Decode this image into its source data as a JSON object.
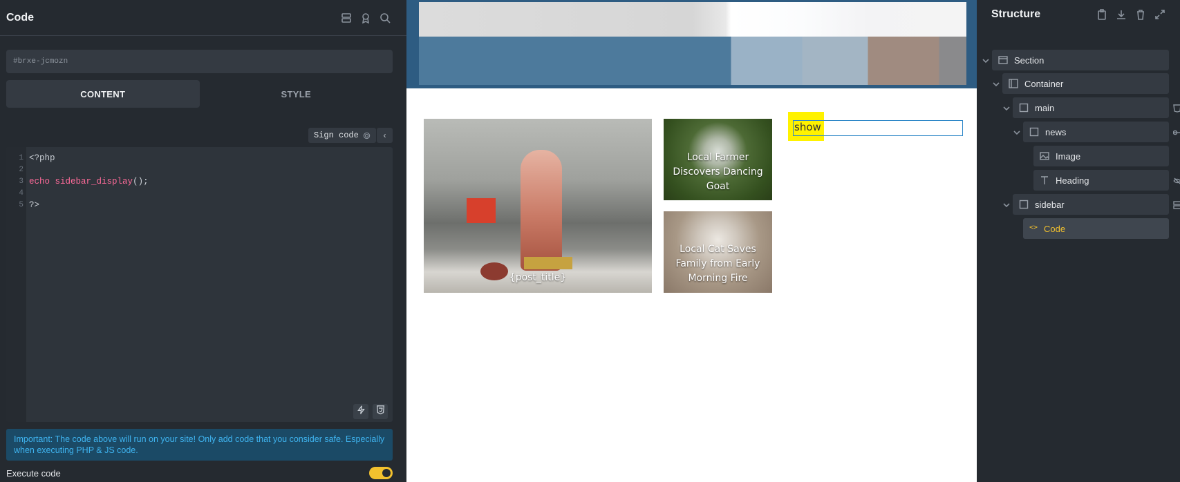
{
  "left_panel": {
    "title": "Code",
    "selector": "#brxe-jcmozn",
    "tabs": [
      "CONTENT",
      "STYLE"
    ],
    "sign_code_label": "Sign code",
    "code_lines": [
      {
        "num": "1",
        "text": "<?php"
      },
      {
        "num": "2",
        "text": ""
      },
      {
        "num": "3",
        "keyword": "echo",
        "func": "sidebar_display",
        "rest": "();"
      },
      {
        "num": "4",
        "text": ""
      },
      {
        "num": "5",
        "text": "?>"
      }
    ],
    "warning": "Important: The code above will run on your site! Only add code that you consider safe. Especially when executing PHP & JS code.",
    "execute_label": "Execute code",
    "execute_enabled": true,
    "accent_color": "#f2c12e"
  },
  "canvas": {
    "news_main_caption": "{post_title}",
    "news_items": [
      "Local Farmer Discovers Dancing Goat",
      "Local Cat Saves Family from Early Morning Fire"
    ],
    "sidebar_output": "show"
  },
  "structure": {
    "title": "Structure",
    "nodes": [
      {
        "label": "Section",
        "icon": "section-icon"
      },
      {
        "label": "Container",
        "icon": "container-icon"
      },
      {
        "label": "main",
        "icon": "block-icon"
      },
      {
        "label": "news",
        "icon": "block-icon"
      },
      {
        "label": "Image",
        "icon": "image-icon"
      },
      {
        "label": "Heading",
        "icon": "heading-icon"
      },
      {
        "label": "sidebar",
        "icon": "block-icon"
      },
      {
        "label": "Code",
        "icon": "code-icon"
      }
    ]
  }
}
